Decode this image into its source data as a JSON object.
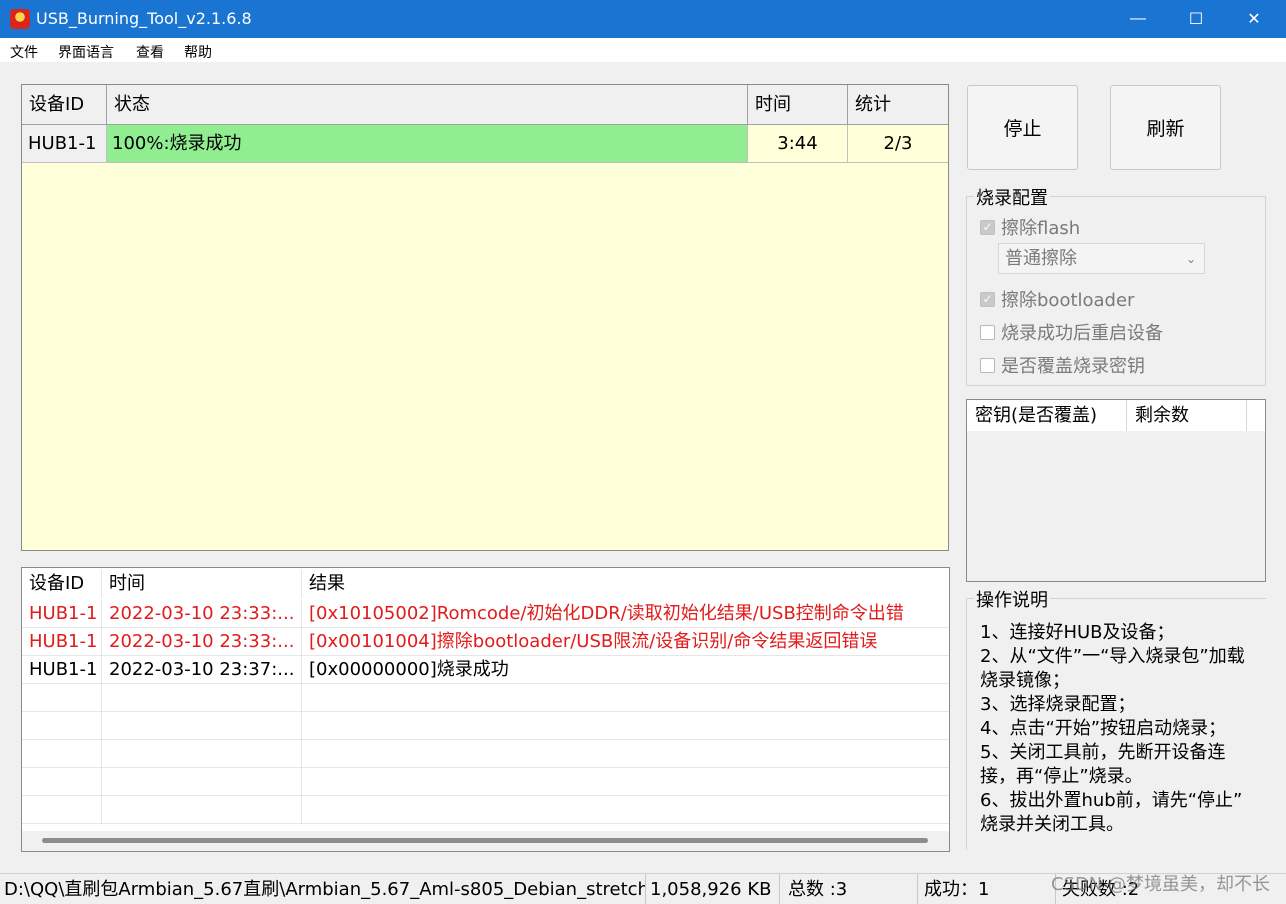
{
  "window": {
    "title": "USB_Burning_Tool_v2.1.6.8"
  },
  "menu": [
    "文件",
    "界面语言",
    "查看",
    "帮助"
  ],
  "device_table": {
    "headers": [
      "设备ID",
      "状态",
      "时间",
      "统计"
    ],
    "rows": [
      {
        "id": "HUB1-1",
        "status": "100%:烧录成功",
        "time": "3:44",
        "stats": "2/3",
        "status_color": "#90ee90"
      }
    ]
  },
  "buttons": {
    "stop": "停止",
    "refresh": "刷新"
  },
  "burn_config": {
    "title": "烧录配置",
    "erase_flash": "擦除flash",
    "erase_mode": "普通擦除",
    "erase_bootloader": "擦除bootloader",
    "reboot_after": "烧录成功后重启设备",
    "overwrite_key": "是否覆盖烧录密钥"
  },
  "key_table": {
    "headers": [
      "密钥(是否覆盖)",
      "剩余数"
    ]
  },
  "log_table": {
    "headers": [
      "设备ID",
      "时间",
      "结果"
    ],
    "rows": [
      {
        "id": "HUB1-1",
        "time": "2022-03-10 23:33:...",
        "result": "[0x10105002]Romcode/初始化DDR/读取初始化结果/USB控制命令出错",
        "error": true
      },
      {
        "id": "HUB1-1",
        "time": "2022-03-10 23:33:...",
        "result": "[0x00101004]擦除bootloader/USB限流/设备识别/命令结果返回错误",
        "error": true
      },
      {
        "id": "HUB1-1",
        "time": "2022-03-10 23:37:...",
        "result": "[0x00000000]烧录成功",
        "error": false
      }
    ]
  },
  "instructions": {
    "title": "操作说明",
    "lines": [
      "1、连接好HUB及设备；",
      "2、从“文件”一“导入烧录包”加载",
      "烧录镜像；",
      "3、选择烧录配置；",
      "4、点击“开始”按钮启动烧录；",
      "5、关闭工具前，先断开设备连",
      "接，再“停止”烧录。",
      "6、拔出外置hub前，请先“停止”",
      "烧录并关闭工具。"
    ]
  },
  "statusbar": {
    "path": "D:\\QQ\\直刷包Armbian_5.67直刷\\Armbian_5.67_Aml-s805_Debian_stretch",
    "size": "1,058,926 KB",
    "total": "总数 :3",
    "success": "成功：1",
    "fail": "失败数 :2"
  },
  "watermark": "CSDN @梦境虽美，却不长",
  "colors": {
    "titlebar": "#1a75d2",
    "error_text": "#e21b1b",
    "success_bg": "#90ee90",
    "device_panel_bg": "#ffffd9"
  }
}
